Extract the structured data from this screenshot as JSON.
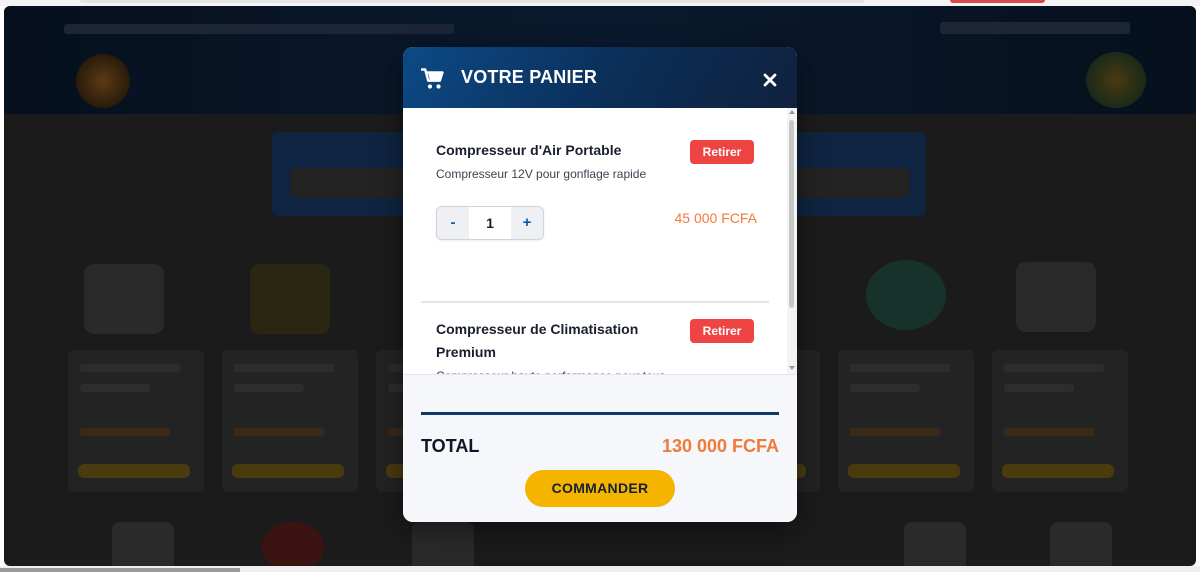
{
  "cart": {
    "title": "VOTRE PANIER",
    "icon": "shopping-cart-icon",
    "close_icon": "close-icon",
    "header_colors": [
      "#0c4a86",
      "#10213d"
    ],
    "items": [
      {
        "name": "Compresseur d'Air Portable",
        "description": "Compresseur 12V pour gonflage rapide",
        "remove_label": "Retirer",
        "quantity": "1",
        "minus_label": "-",
        "plus_label": "+",
        "price": "45 000 FCFA"
      },
      {
        "name": "Compresseur de Climatisation Premium",
        "description": "Compresseur haute performance pour tous véhicules",
        "remove_label": "Retirer"
      }
    ],
    "total_label": "TOTAL",
    "total_value": "130 000 FCFA",
    "order_label": "COMMANDER",
    "accent_color": "#f4b400",
    "price_color": "#f07a3a",
    "remove_color": "#ef4444"
  }
}
